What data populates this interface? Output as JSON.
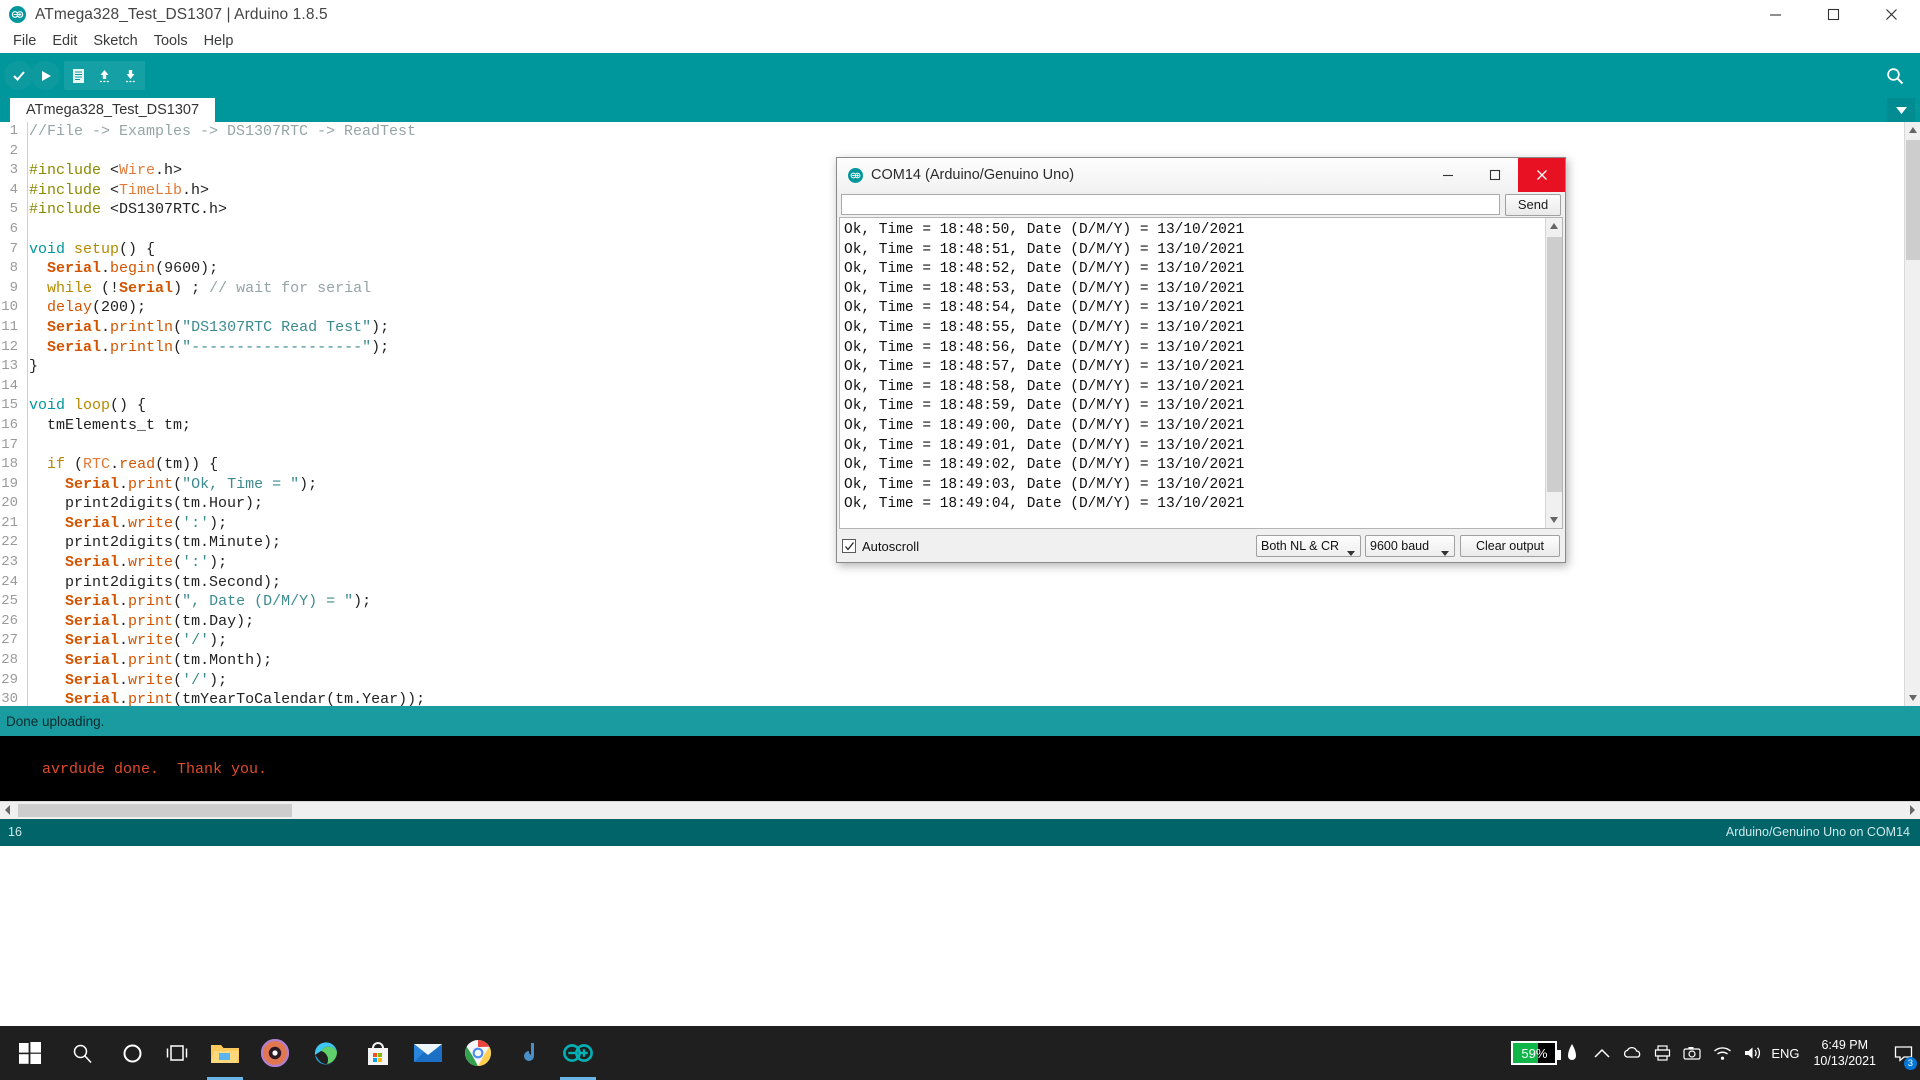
{
  "window": {
    "title": "ATmega328_Test_DS1307 | Arduino 1.8.5",
    "minimize_label": "Minimize",
    "maximize_label": "Maximize",
    "close_label": "Close"
  },
  "menu": {
    "items": [
      "File",
      "Edit",
      "Sketch",
      "Tools",
      "Help"
    ]
  },
  "toolbar": {
    "verify_label": "Verify",
    "upload_label": "Upload",
    "new_label": "New",
    "open_label": "Open",
    "save_label": "Save",
    "serial_monitor_label": "Serial Monitor"
  },
  "tabs": {
    "sketch_name": "ATmega328_Test_DS1307"
  },
  "editor": {
    "lines": [
      {
        "n": "1",
        "tokens": [
          {
            "t": "//File -> Examples -> DS1307RTC -> ReadTest",
            "c": "k-cmt"
          }
        ]
      },
      {
        "n": "2",
        "tokens": []
      },
      {
        "n": "3",
        "tokens": [
          {
            "t": "#include ",
            "c": "k-pre"
          },
          {
            "t": "<",
            "c": "k-type"
          },
          {
            "t": "Wire",
            "c": "k-lib"
          },
          {
            "t": ".h>",
            "c": "k-type"
          }
        ]
      },
      {
        "n": "4",
        "tokens": [
          {
            "t": "#include ",
            "c": "k-pre"
          },
          {
            "t": "<",
            "c": "k-type"
          },
          {
            "t": "TimeLib",
            "c": "k-lib"
          },
          {
            "t": ".h>",
            "c": "k-type"
          }
        ]
      },
      {
        "n": "5",
        "tokens": [
          {
            "t": "#include ",
            "c": "k-pre"
          },
          {
            "t": "<DS1307RTC.h>",
            "c": "k-type"
          }
        ]
      },
      {
        "n": "6",
        "tokens": []
      },
      {
        "n": "7",
        "tokens": [
          {
            "t": "void",
            "c": "k-void"
          },
          {
            "t": " ",
            "c": "k-type"
          },
          {
            "t": "setup",
            "c": "k-name"
          },
          {
            "t": "() {",
            "c": "k-type"
          }
        ]
      },
      {
        "n": "8",
        "tokens": [
          {
            "t": "  ",
            "c": "k-type"
          },
          {
            "t": "Serial",
            "c": "k-kw2"
          },
          {
            "t": ".",
            "c": "k-type"
          },
          {
            "t": "begin",
            "c": "k-fn"
          },
          {
            "t": "(",
            "c": "k-type"
          },
          {
            "t": "9600",
            "c": "k-type"
          },
          {
            "t": ");",
            "c": "k-type"
          }
        ]
      },
      {
        "n": "9",
        "tokens": [
          {
            "t": "  ",
            "c": "k-type"
          },
          {
            "t": "while",
            "c": "k-name"
          },
          {
            "t": " (!",
            "c": "k-type"
          },
          {
            "t": "Serial",
            "c": "k-kw2"
          },
          {
            "t": ") ; ",
            "c": "k-type"
          },
          {
            "t": "// wait for serial",
            "c": "k-cmt"
          }
        ]
      },
      {
        "n": "10",
        "tokens": [
          {
            "t": "  ",
            "c": "k-type"
          },
          {
            "t": "delay",
            "c": "k-fn"
          },
          {
            "t": "(200);",
            "c": "k-type"
          }
        ]
      },
      {
        "n": "11",
        "tokens": [
          {
            "t": "  ",
            "c": "k-type"
          },
          {
            "t": "Serial",
            "c": "k-kw2"
          },
          {
            "t": ".",
            "c": "k-type"
          },
          {
            "t": "println",
            "c": "k-fn"
          },
          {
            "t": "(",
            "c": "k-type"
          },
          {
            "t": "\"DS1307RTC Read Test\"",
            "c": "k-str"
          },
          {
            "t": ");",
            "c": "k-type"
          }
        ]
      },
      {
        "n": "12",
        "tokens": [
          {
            "t": "  ",
            "c": "k-type"
          },
          {
            "t": "Serial",
            "c": "k-kw2"
          },
          {
            "t": ".",
            "c": "k-type"
          },
          {
            "t": "println",
            "c": "k-fn"
          },
          {
            "t": "(",
            "c": "k-type"
          },
          {
            "t": "\"-------------------\"",
            "c": "k-str"
          },
          {
            "t": ");",
            "c": "k-type"
          }
        ]
      },
      {
        "n": "13",
        "tokens": [
          {
            "t": "}",
            "c": "k-type"
          }
        ]
      },
      {
        "n": "14",
        "tokens": []
      },
      {
        "n": "15",
        "tokens": [
          {
            "t": "void",
            "c": "k-void"
          },
          {
            "t": " ",
            "c": "k-type"
          },
          {
            "t": "loop",
            "c": "k-name"
          },
          {
            "t": "() {",
            "c": "k-type"
          }
        ]
      },
      {
        "n": "16",
        "tokens": [
          {
            "t": "  tmElements_t tm;",
            "c": "k-type"
          }
        ]
      },
      {
        "n": "17",
        "tokens": []
      },
      {
        "n": "18",
        "tokens": [
          {
            "t": "  ",
            "c": "k-type"
          },
          {
            "t": "if",
            "c": "k-name"
          },
          {
            "t": " (",
            "c": "k-type"
          },
          {
            "t": "RTC",
            "c": "k-lib"
          },
          {
            "t": ".",
            "c": "k-type"
          },
          {
            "t": "read",
            "c": "k-fn"
          },
          {
            "t": "(tm)) {",
            "c": "k-type"
          }
        ]
      },
      {
        "n": "19",
        "tokens": [
          {
            "t": "    ",
            "c": "k-type"
          },
          {
            "t": "Serial",
            "c": "k-kw2"
          },
          {
            "t": ".",
            "c": "k-type"
          },
          {
            "t": "print",
            "c": "k-fn"
          },
          {
            "t": "(",
            "c": "k-type"
          },
          {
            "t": "\"Ok, Time = \"",
            "c": "k-str"
          },
          {
            "t": ");",
            "c": "k-type"
          }
        ]
      },
      {
        "n": "20",
        "tokens": [
          {
            "t": "    print2digits(tm.Hour);",
            "c": "k-type"
          }
        ]
      },
      {
        "n": "21",
        "tokens": [
          {
            "t": "    ",
            "c": "k-type"
          },
          {
            "t": "Serial",
            "c": "k-kw2"
          },
          {
            "t": ".",
            "c": "k-type"
          },
          {
            "t": "write",
            "c": "k-fn"
          },
          {
            "t": "(",
            "c": "k-type"
          },
          {
            "t": "':'",
            "c": "k-str"
          },
          {
            "t": ");",
            "c": "k-type"
          }
        ]
      },
      {
        "n": "22",
        "tokens": [
          {
            "t": "    print2digits(tm.Minute);",
            "c": "k-type"
          }
        ]
      },
      {
        "n": "23",
        "tokens": [
          {
            "t": "    ",
            "c": "k-type"
          },
          {
            "t": "Serial",
            "c": "k-kw2"
          },
          {
            "t": ".",
            "c": "k-type"
          },
          {
            "t": "write",
            "c": "k-fn"
          },
          {
            "t": "(",
            "c": "k-type"
          },
          {
            "t": "':'",
            "c": "k-str"
          },
          {
            "t": ");",
            "c": "k-type"
          }
        ]
      },
      {
        "n": "24",
        "tokens": [
          {
            "t": "    print2digits(tm.Second);",
            "c": "k-type"
          }
        ]
      },
      {
        "n": "25",
        "tokens": [
          {
            "t": "    ",
            "c": "k-type"
          },
          {
            "t": "Serial",
            "c": "k-kw2"
          },
          {
            "t": ".",
            "c": "k-type"
          },
          {
            "t": "print",
            "c": "k-fn"
          },
          {
            "t": "(",
            "c": "k-type"
          },
          {
            "t": "\", Date (D/M/Y) = \"",
            "c": "k-str"
          },
          {
            "t": ");",
            "c": "k-type"
          }
        ]
      },
      {
        "n": "26",
        "tokens": [
          {
            "t": "    ",
            "c": "k-type"
          },
          {
            "t": "Serial",
            "c": "k-kw2"
          },
          {
            "t": ".",
            "c": "k-type"
          },
          {
            "t": "print",
            "c": "k-fn"
          },
          {
            "t": "(tm.Day);",
            "c": "k-type"
          }
        ]
      },
      {
        "n": "27",
        "tokens": [
          {
            "t": "    ",
            "c": "k-type"
          },
          {
            "t": "Serial",
            "c": "k-kw2"
          },
          {
            "t": ".",
            "c": "k-type"
          },
          {
            "t": "write",
            "c": "k-fn"
          },
          {
            "t": "(",
            "c": "k-type"
          },
          {
            "t": "'/'",
            "c": "k-str"
          },
          {
            "t": ");",
            "c": "k-type"
          }
        ]
      },
      {
        "n": "28",
        "tokens": [
          {
            "t": "    ",
            "c": "k-type"
          },
          {
            "t": "Serial",
            "c": "k-kw2"
          },
          {
            "t": ".",
            "c": "k-type"
          },
          {
            "t": "print",
            "c": "k-fn"
          },
          {
            "t": "(tm.Month);",
            "c": "k-type"
          }
        ]
      },
      {
        "n": "29",
        "tokens": [
          {
            "t": "    ",
            "c": "k-type"
          },
          {
            "t": "Serial",
            "c": "k-kw2"
          },
          {
            "t": ".",
            "c": "k-type"
          },
          {
            "t": "write",
            "c": "k-fn"
          },
          {
            "t": "(",
            "c": "k-type"
          },
          {
            "t": "'/'",
            "c": "k-str"
          },
          {
            "t": ");",
            "c": "k-type"
          }
        ]
      },
      {
        "n": "30",
        "tokens": [
          {
            "t": "    ",
            "c": "k-type"
          },
          {
            "t": "Serial",
            "c": "k-kw2"
          },
          {
            "t": ".",
            "c": "k-type"
          },
          {
            "t": "print",
            "c": "k-fn"
          },
          {
            "t": "(tmYearToCalendar(tm.Year));",
            "c": "k-type"
          }
        ]
      }
    ]
  },
  "status": {
    "message": "Done uploading.",
    "console_text": "avrdude done.  Thank you.",
    "line_number": "16",
    "board_info": "Arduino/Genuino Uno on COM14"
  },
  "serial_monitor": {
    "title": "COM14 (Arduino/Genuino Uno)",
    "minimize_label": "Minimize",
    "maximize_label": "Maximize",
    "close_label": "Close",
    "input_value": "",
    "input_placeholder": "",
    "send_label": "Send",
    "autoscroll_label": "Autoscroll",
    "autoscroll_checked": true,
    "line_ending": "Both NL & CR",
    "baud_rate": "9600 baud",
    "clear_output_label": "Clear output",
    "output_lines": [
      "Ok, Time = 18:48:50, Date (D/M/Y) = 13/10/2021",
      "Ok, Time = 18:48:51, Date (D/M/Y) = 13/10/2021",
      "Ok, Time = 18:48:52, Date (D/M/Y) = 13/10/2021",
      "Ok, Time = 18:48:53, Date (D/M/Y) = 13/10/2021",
      "Ok, Time = 18:48:54, Date (D/M/Y) = 13/10/2021",
      "Ok, Time = 18:48:55, Date (D/M/Y) = 13/10/2021",
      "Ok, Time = 18:48:56, Date (D/M/Y) = 13/10/2021",
      "Ok, Time = 18:48:57, Date (D/M/Y) = 13/10/2021",
      "Ok, Time = 18:48:58, Date (D/M/Y) = 13/10/2021",
      "Ok, Time = 18:48:59, Date (D/M/Y) = 13/10/2021",
      "Ok, Time = 18:49:00, Date (D/M/Y) = 13/10/2021",
      "Ok, Time = 18:49:01, Date (D/M/Y) = 13/10/2021",
      "Ok, Time = 18:49:02, Date (D/M/Y) = 13/10/2021",
      "Ok, Time = 18:49:03, Date (D/M/Y) = 13/10/2021",
      "Ok, Time = 18:49:04, Date (D/M/Y) = 13/10/2021"
    ]
  },
  "taskbar": {
    "start_label": "Start",
    "search_label": "Search",
    "cortana_label": "Cortana",
    "taskview_label": "Task View",
    "apps": [
      "file-explorer",
      "media-player",
      "microsoft-edge",
      "microsoft-store",
      "mail",
      "google-chrome",
      "arduino-java",
      "arduino-ide"
    ],
    "battery_percent": "59%",
    "language": "ENG",
    "time": "6:49 PM",
    "date": "10/13/2021",
    "notification_count": "3"
  },
  "colors": {
    "arduino_teal": "#00979c",
    "arduino_dark_teal": "#006468",
    "status_teal": "#1a9ba0",
    "console_orange": "#e04b2a",
    "close_red": "#e81123",
    "battery_green": "#10b64a"
  }
}
